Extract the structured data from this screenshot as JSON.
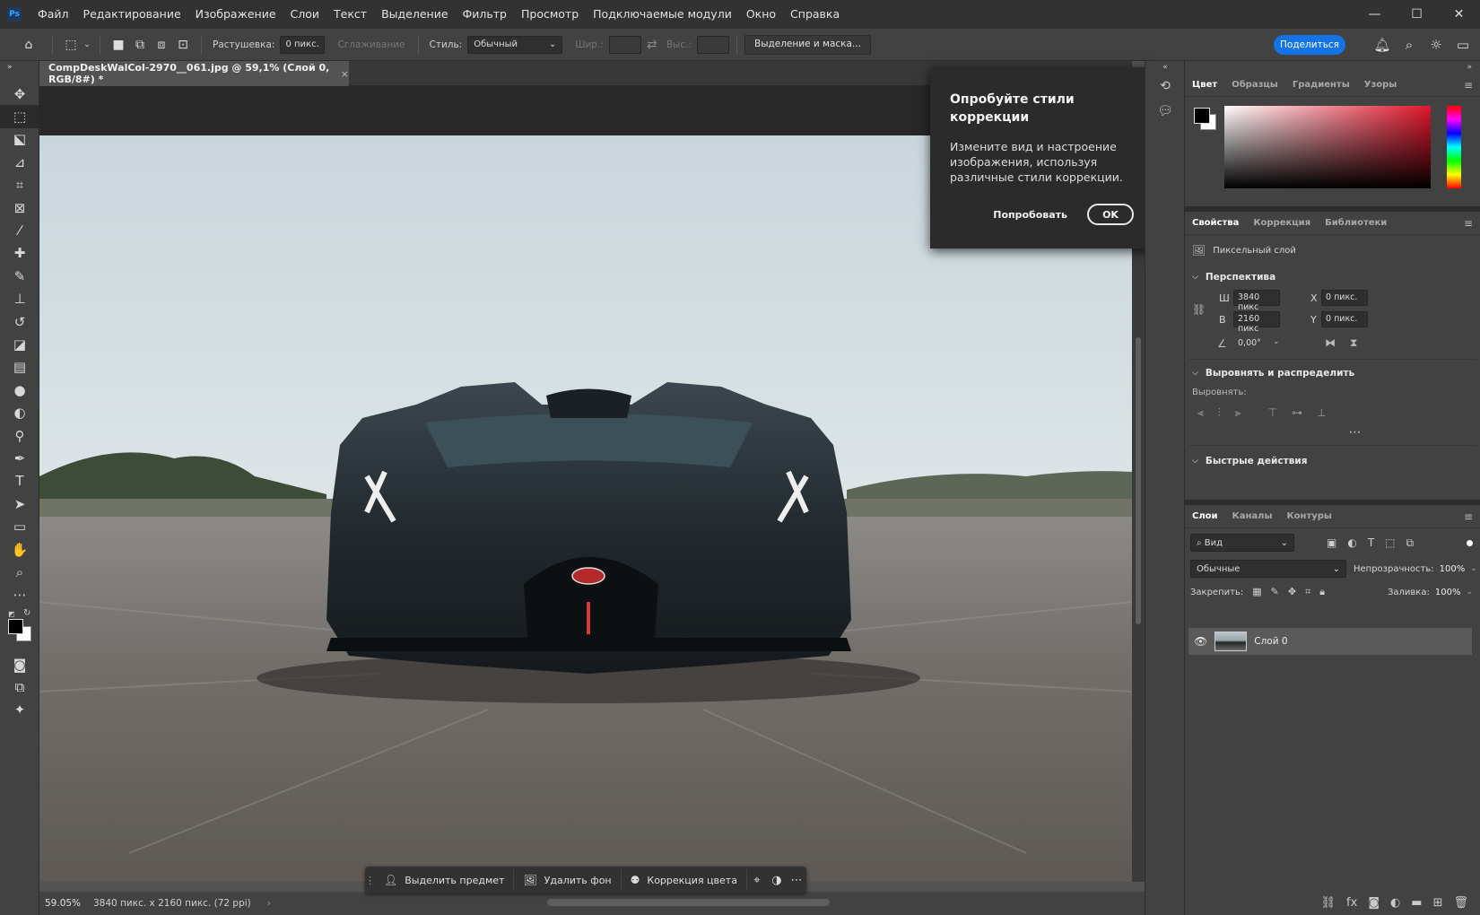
{
  "app": {
    "logo": "Ps",
    "menu": [
      "Файл",
      "Редактирование",
      "Изображение",
      "Слои",
      "Текст",
      "Выделение",
      "Фильтр",
      "Просмотр",
      "Подключаемые модули",
      "Окно",
      "Справка"
    ]
  },
  "options_bar": {
    "feather_label": "Растушевка:",
    "feather_value": "0 пикс.",
    "antialias_label": "Сглаживание",
    "style_label": "Стиль:",
    "style_value": "Обычный",
    "width_label": "Шир.:",
    "height_label": "Выс.:",
    "select_mask_label": "Выделение и маска...",
    "share_label": "Поделиться"
  },
  "document": {
    "tab_title": "CompDeskWalCol-2970__061.jpg @ 59,1% (Слой 0, RGB/8#) *",
    "zoom": "59.05%",
    "info": "3840 пикс. x 2160 пикс. (72 ppi)"
  },
  "taskbar": {
    "select_subject": "Выделить предмет",
    "remove_bg": "Удалить фон",
    "color_correction": "Коррекция цвета"
  },
  "coach": {
    "title": "Опробуйте стили коррекции",
    "body": "Измените вид и настроение изображения, используя различные стили коррекции.",
    "try_label": "Попробовать",
    "ok_label": "OK"
  },
  "color_panel": {
    "tabs": [
      "Цвет",
      "Образцы",
      "Градиенты",
      "Узоры"
    ],
    "foreground": "#000000",
    "background": "#ffffff",
    "hue_color": "#e0162b"
  },
  "properties_panel": {
    "tabs": [
      "Свойства",
      "Коррекция",
      "Библиотеки"
    ],
    "layer_type": "Пиксельный слой",
    "transform_heading": "Перспектива",
    "w_label": "Ш",
    "w_value": "3840 пикс",
    "h_label": "В",
    "h_value": "2160 пикс",
    "x_label": "X",
    "x_value": "0 пикс.",
    "y_label": "Y",
    "y_value": "0 пикс.",
    "angle_value": "0,00°",
    "align_heading": "Выровнять и распределить",
    "align_label": "Выровнять:",
    "quick_actions_heading": "Быстрые действия"
  },
  "layers_panel": {
    "tabs": [
      "Слои",
      "Каналы",
      "Контуры"
    ],
    "filter_value": "Вид",
    "blend_mode": "Обычные",
    "opacity_label": "Непрозрачность:",
    "opacity_value": "100%",
    "lock_label": "Закрепить:",
    "fill_label": "Заливка:",
    "fill_value": "100%",
    "layer_name": "Слой 0"
  }
}
